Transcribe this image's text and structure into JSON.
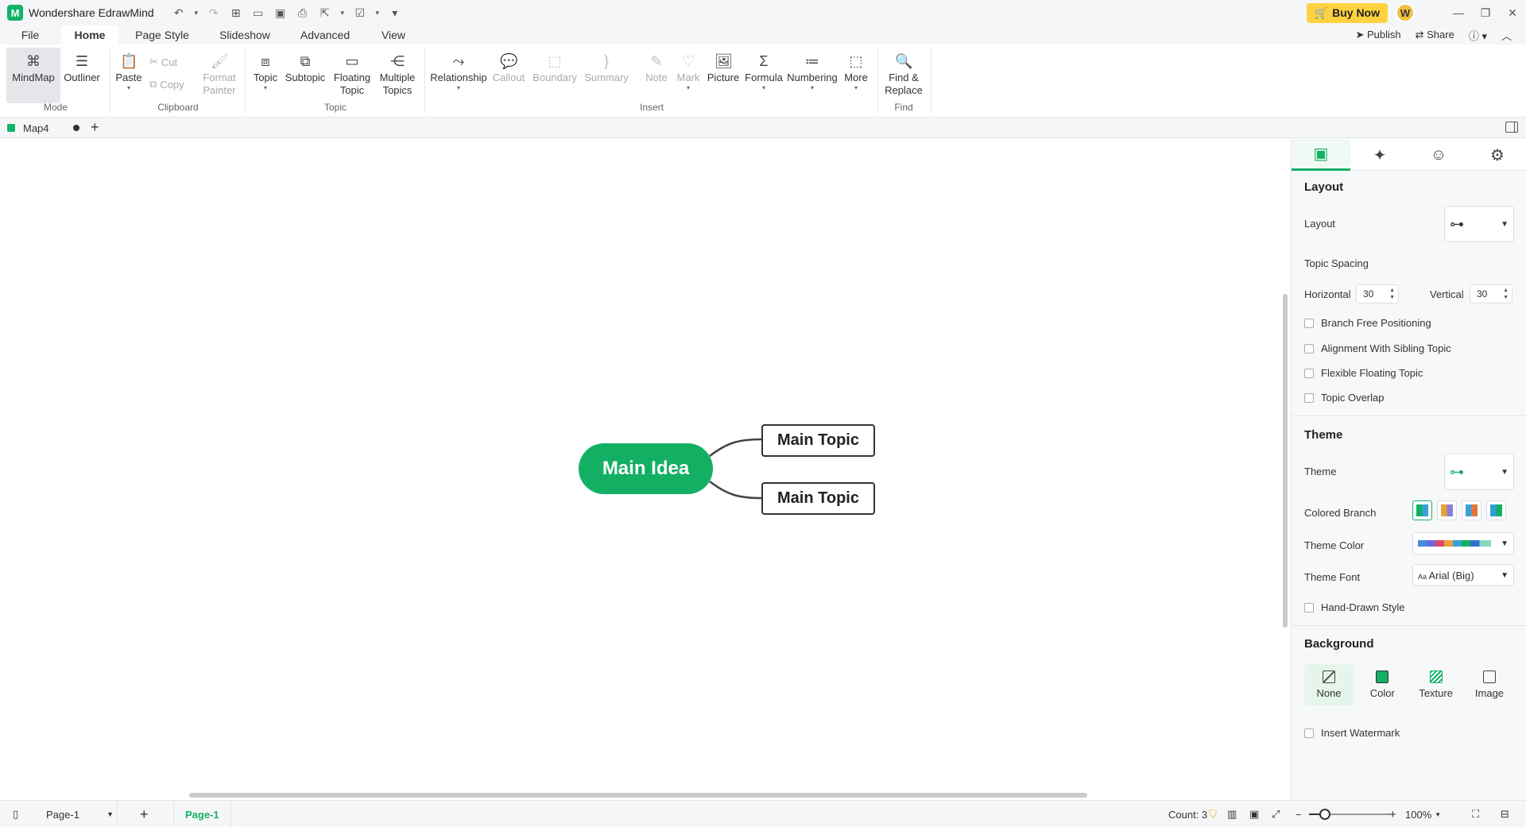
{
  "titlebar": {
    "app_name": "Wondershare EdrawMind",
    "buy_now": "Buy Now",
    "avatar_letter": "W"
  },
  "ribbon_tabs": {
    "file": "File",
    "home": "Home",
    "page_style": "Page Style",
    "slideshow": "Slideshow",
    "advanced": "Advanced",
    "view": "View",
    "publish": "Publish",
    "share": "Share"
  },
  "ribbon": {
    "mindmap": "MindMap",
    "outliner": "Outliner",
    "paste": "Paste",
    "cut": "Cut",
    "copy": "Copy",
    "format_painter_1": "Format",
    "format_painter_2": "Painter",
    "topic": "Topic",
    "subtopic": "Subtopic",
    "floating_topic_1": "Floating",
    "floating_topic_2": "Topic",
    "multiple_topics_1": "Multiple",
    "multiple_topics_2": "Topics",
    "relationship": "Relationship",
    "callout": "Callout",
    "boundary": "Boundary",
    "summary": "Summary",
    "note": "Note",
    "mark": "Mark",
    "picture": "Picture",
    "formula": "Formula",
    "numbering": "Numbering",
    "more": "More",
    "find_replace_1": "Find &",
    "find_replace_2": "Replace",
    "groups": {
      "mode": "Mode",
      "clipboard": "Clipboard",
      "topic": "Topic",
      "insert": "Insert",
      "find": "Find"
    }
  },
  "doc_tab": {
    "name": "Map4"
  },
  "canvas": {
    "central_topic": "Main Idea",
    "main_topics": [
      "Main Topic",
      "Main Topic"
    ],
    "central_color": "#13b064"
  },
  "panel": {
    "layout_heading": "Layout",
    "layout_label": "Layout",
    "topic_spacing": "Topic Spacing",
    "horizontal_label": "Horizontal",
    "horizontal_value": "30",
    "vertical_label": "Vertical",
    "vertical_value": "30",
    "checkboxes": {
      "branch_free": "Branch Free Positioning",
      "alignment": "Alignment With Sibling Topic",
      "flexible": "Flexible Floating Topic",
      "overlap": "Topic Overlap"
    },
    "theme_heading": "Theme",
    "theme_label": "Theme",
    "colored_branch": "Colored Branch",
    "theme_color": "Theme Color",
    "theme_font": "Theme Font",
    "theme_font_value": "Arial (Big)",
    "hand_drawn": "Hand-Drawn Style",
    "background_heading": "Background",
    "bg_none": "None",
    "bg_color": "Color",
    "bg_texture": "Texture",
    "bg_image": "Image",
    "insert_watermark": "Insert Watermark"
  },
  "statusbar": {
    "page_select": "Page-1",
    "page_tab": "Page-1",
    "count": "Count: 3",
    "zoom": "100%"
  }
}
